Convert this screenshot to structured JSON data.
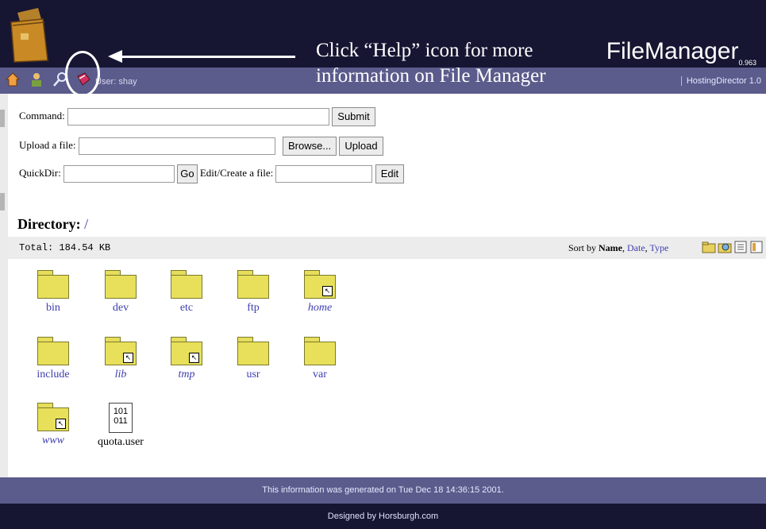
{
  "header": {
    "title": "FileManager",
    "version": "0.963",
    "user_label": "User: shay",
    "callout_line1": "Click “Help” icon for more",
    "callout_line2": "information on File Manager",
    "director_link": "HostingDirector 1.0",
    "toolbar_icons": [
      "home-icon",
      "users-icon",
      "search-icon",
      "help-icon"
    ]
  },
  "form": {
    "command_label": "Command:",
    "submit_label": "Submit",
    "upload_label": "Upload a file:",
    "browse_label": "Browse...",
    "upload_button": "Upload",
    "quickdir_label": "QuickDir:",
    "go_label": "Go",
    "edit_label": "Edit/Create a file:",
    "edit_button": "Edit"
  },
  "directory": {
    "label": "Directory:",
    "path": "/",
    "total": "Total: 184.54 KB",
    "sort_prefix": "Sort by",
    "sort_name": "Name",
    "sort_date": "Date",
    "sort_type": "Type"
  },
  "items": [
    {
      "name": "bin",
      "type": "folder",
      "link": false
    },
    {
      "name": "dev",
      "type": "folder",
      "link": false
    },
    {
      "name": "etc",
      "type": "folder",
      "link": false
    },
    {
      "name": "ftp",
      "type": "folder",
      "link": false
    },
    {
      "name": "home",
      "type": "folder",
      "link": true
    },
    {
      "name": "include",
      "type": "folder",
      "link": false
    },
    {
      "name": "lib",
      "type": "folder",
      "link": true
    },
    {
      "name": "tmp",
      "type": "folder",
      "link": true
    },
    {
      "name": "usr",
      "type": "folder",
      "link": false
    },
    {
      "name": "var",
      "type": "folder",
      "link": false
    },
    {
      "name": "www",
      "type": "folder",
      "link": true
    },
    {
      "name": "quota.user",
      "type": "file",
      "link": false,
      "glyph1": "101",
      "glyph2": "011"
    }
  ],
  "footer": {
    "generated": "This information was generated on Tue Dec 18 14:36:15 2001.",
    "designed": "Designed by Horsburgh.com"
  },
  "colors": {
    "header_dark": "#161633",
    "header_bar": "#5b5b8c",
    "link": "#3d3db0",
    "folder": "#e8e05a"
  }
}
